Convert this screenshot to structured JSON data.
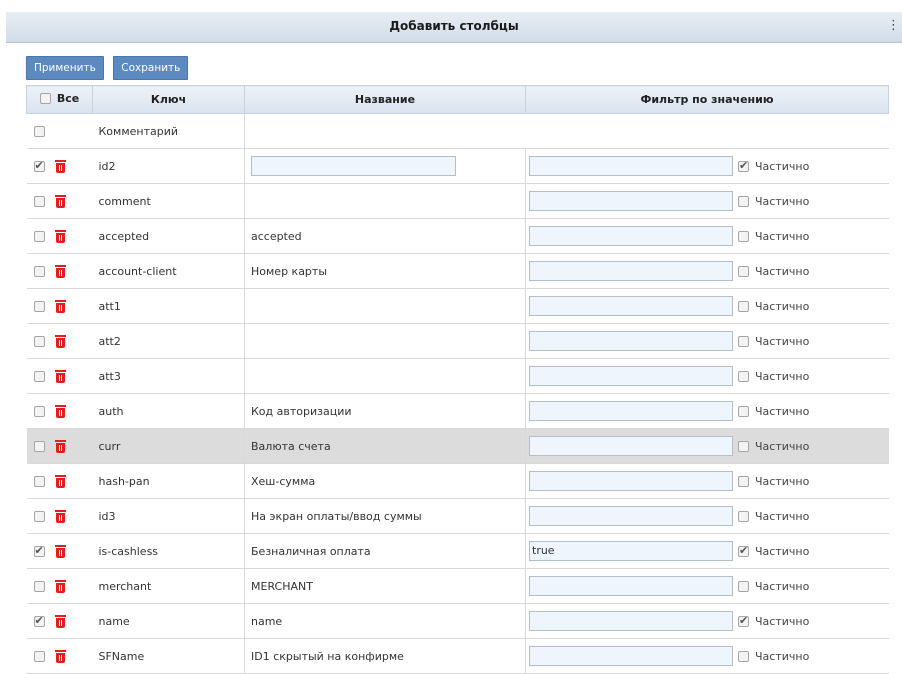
{
  "dialog": {
    "title": "Добавить столбцы"
  },
  "toolbar": {
    "apply_label": "Применить",
    "save_label": "Сохранить"
  },
  "table": {
    "headers": {
      "all": "Все",
      "key": "Ключ",
      "name": "Название",
      "filter": "Фильтр по значению"
    },
    "partial_label": "Частично",
    "comment_row": {
      "key": "Комментарий"
    },
    "rows": [
      {
        "key": "id2",
        "name": "",
        "checked": true,
        "name_input": true,
        "filter_value": "",
        "partial": true
      },
      {
        "key": "comment",
        "name": "",
        "checked": false,
        "name_input": false,
        "filter_value": "",
        "partial": false
      },
      {
        "key": "accepted",
        "name": "accepted",
        "checked": false,
        "name_input": false,
        "filter_value": "",
        "partial": false
      },
      {
        "key": "account-client",
        "name": "Номер карты",
        "checked": false,
        "name_input": false,
        "filter_value": "",
        "partial": false
      },
      {
        "key": "att1",
        "name": "",
        "checked": false,
        "name_input": false,
        "filter_value": "",
        "partial": false
      },
      {
        "key": "att2",
        "name": "",
        "checked": false,
        "name_input": false,
        "filter_value": "",
        "partial": false
      },
      {
        "key": "att3",
        "name": "",
        "checked": false,
        "name_input": false,
        "filter_value": "",
        "partial": false
      },
      {
        "key": "auth",
        "name": "Код авторизации",
        "checked": false,
        "name_input": false,
        "filter_value": "",
        "partial": false
      },
      {
        "key": "curr",
        "name": "Валюта счета",
        "checked": false,
        "name_input": false,
        "filter_value": "",
        "partial": false,
        "highlighted": true
      },
      {
        "key": "hash-pan",
        "name": "Хеш-сумма",
        "checked": false,
        "name_input": false,
        "filter_value": "",
        "partial": false
      },
      {
        "key": "id3",
        "name": "На экран оплаты/ввод суммы",
        "checked": false,
        "name_input": false,
        "filter_value": "",
        "partial": false
      },
      {
        "key": "is-cashless",
        "name": "Безналичная оплата",
        "checked": true,
        "name_input": false,
        "filter_value": "true",
        "partial": true
      },
      {
        "key": "merchant",
        "name": "MERCHANT",
        "checked": false,
        "name_input": false,
        "filter_value": "",
        "partial": false
      },
      {
        "key": "name",
        "name": "name",
        "checked": true,
        "name_input": false,
        "filter_value": "",
        "partial": true
      },
      {
        "key": "SFName",
        "name": "ID1 скрытый на конфирме",
        "checked": false,
        "name_input": false,
        "filter_value": "",
        "partial": false
      }
    ]
  }
}
